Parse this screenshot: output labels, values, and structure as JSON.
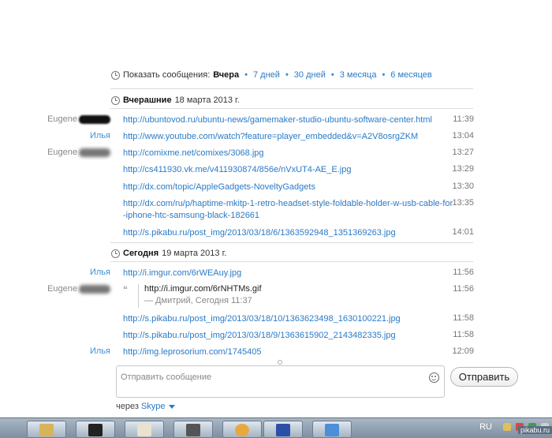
{
  "filter": {
    "label": "Показать сообщения:",
    "selected": "Вчера",
    "options": [
      "7 дней",
      "30 дней",
      "3 месяца",
      "6 месяцев"
    ],
    "separator": "•"
  },
  "days": [
    {
      "label": "Вчерашние",
      "date": "18 марта 2013 г."
    },
    {
      "label": "Сегодня",
      "date": "19 марта 2013 г."
    }
  ],
  "messages": [
    {
      "sender": "Eugene",
      "text": "http://ubuntovod.ru/ubuntu-news/gamemaker-studio-ubuntu-software-center.html",
      "time": "11:39"
    },
    {
      "sender": "Илья",
      "text": "http://www.youtube.com/watch?feature=player_embedded&v=A2V8osrgZKM",
      "time": "13:04"
    },
    {
      "sender": "Eugene",
      "text": "http://comixme.net/comixes/3068.jpg",
      "time": "13:27"
    },
    {
      "sender": "",
      "text": "http://cs411930.vk.me/v411930874/856e/nVxUT4-AE_E.jpg",
      "time": "13:29"
    },
    {
      "sender": "",
      "text": "http://dx.com/topic/AppleGadgets-NoveltyGadgets",
      "time": "13:30"
    },
    {
      "sender": "",
      "text": "http://dx.com/ru/p/haptime-mkitp-1-retro-headset-style-foldable-holder-w-usb-cable-for-iphone-htc-samsung-black-182661",
      "text_line1": "http://dx.com/ru/p/haptime-mkitp-1-retro-headset-style-foldable-holder-w-usb-cable-for",
      "text_line2": "-iphone-htc-samsung-black-182661",
      "time": "13:35"
    },
    {
      "sender": "",
      "text": "http://s.pikabu.ru/post_img/2013/03/18/6/1363592948_1351369263.jpg",
      "time": "14:01"
    },
    {
      "sender": "Илья",
      "text": "http://i.imgur.com/6rWEAuy.jpg",
      "time": "11:56"
    },
    {
      "sender": "Eugene",
      "quote_text": "http://i.imgur.com/6rNHTMs.gif",
      "quote_author": "— Дмитрий, Сегодня 11:37",
      "time": "11:56"
    },
    {
      "sender": "",
      "text": "http://s.pikabu.ru/post_img/2013/03/18/10/1363623498_1630100221.jpg",
      "time": "11:58"
    },
    {
      "sender": "",
      "text": "http://s.pikabu.ru/post_img/2013/03/18/9/1363615902_2143482335.jpg",
      "time": "11:58"
    },
    {
      "sender": "Илья",
      "text": "http://img.leprosorium.com/1745405",
      "time": "12:09"
    }
  ],
  "composer": {
    "placeholder": "Отправить сообщение",
    "send_label": "Отправить",
    "via_label": "через",
    "via_service": "Skype"
  },
  "taskbar": {
    "language": "RU"
  },
  "watermark": "pikabu.ru"
}
